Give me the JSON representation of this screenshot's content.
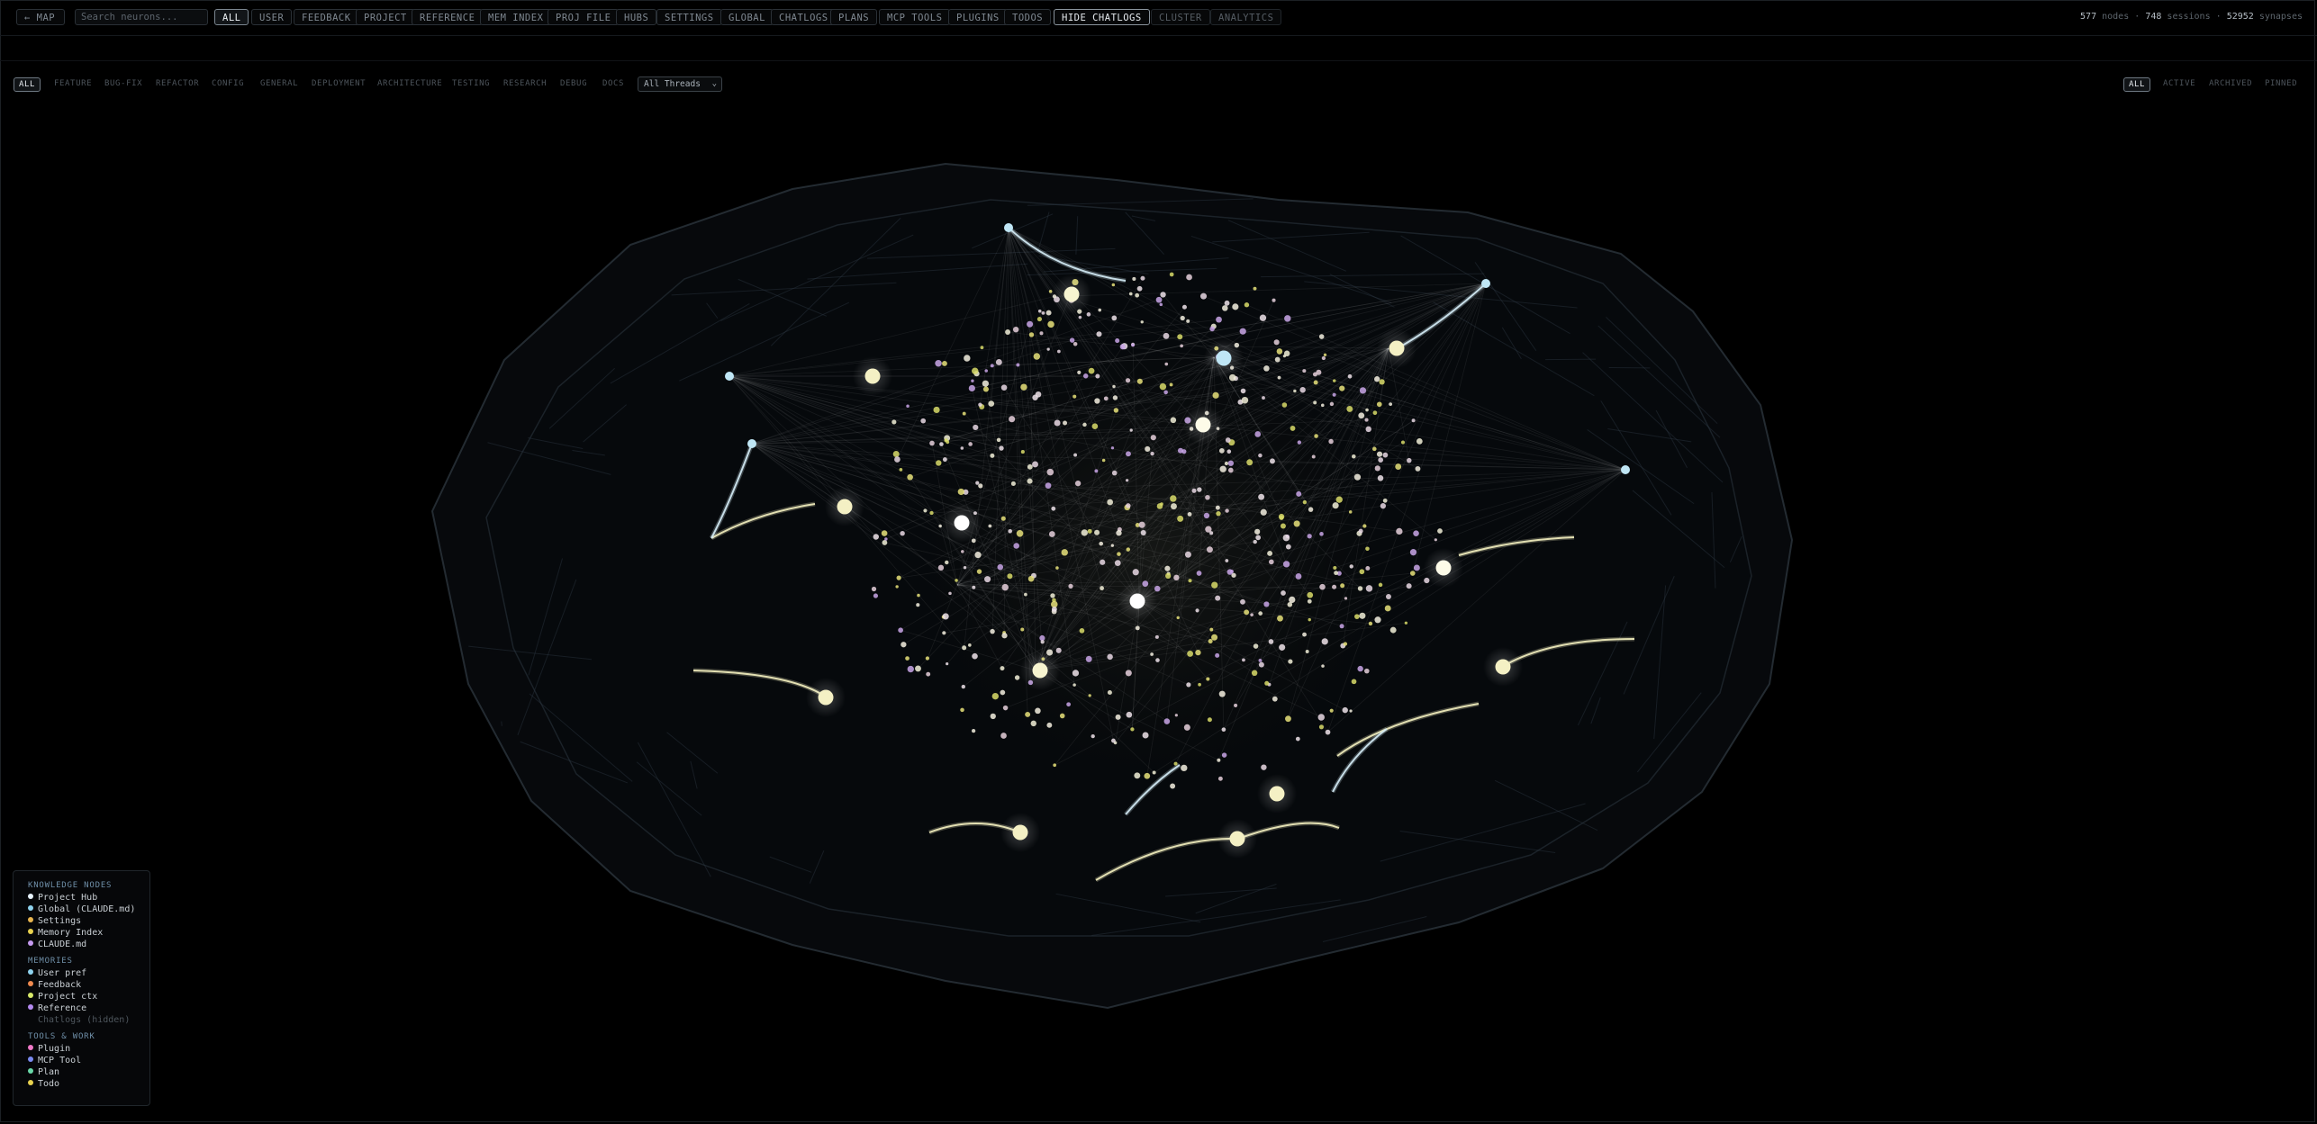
{
  "toolbar": {
    "back_label": "← MAP",
    "search_placeholder": "Search neurons...",
    "filters": [
      "ALL",
      "USER",
      "FEEDBACK",
      "PROJECT",
      "REFERENCE",
      "MEM INDEX",
      "PROJ FILE",
      "HUBS",
      "SETTINGS",
      "GLOBAL",
      "CHATLOGS",
      "PLANS",
      "MCP TOOLS",
      "PLUGINS",
      "TODOS"
    ],
    "active_filter": "ALL",
    "hide_chatlogs_label": "HIDE CHATLOGS",
    "cluster_label": "CLUSTER",
    "analytics_label": "ANALYTICS"
  },
  "stats": {
    "nodes": "577",
    "nodes_label": "nodes",
    "sessions": "748",
    "sessions_label": "sessions",
    "synapses": "52952",
    "synapses_label": "synapses",
    "separator": "·"
  },
  "categories": {
    "items": [
      "ALL",
      "FEATURE",
      "BUG-FIX",
      "REFACTOR",
      "CONFIG",
      "GENERAL",
      "DEPLOYMENT",
      "ARCHITECTURE",
      "TESTING",
      "RESEARCH",
      "DEBUG",
      "DOCS"
    ],
    "active": "ALL",
    "threads_label": "All Threads"
  },
  "status_filters": {
    "items": [
      "ALL",
      "ACTIVE",
      "ARCHIVED",
      "PINNED"
    ],
    "active": "ALL"
  },
  "legend": {
    "knowledge_title": "KNOWLEDGE NODES",
    "knowledge": [
      {
        "label": "Project Hub",
        "color": "#e8f4ff"
      },
      {
        "label": "Global (CLAUDE.md)",
        "color": "#8fd3ee"
      },
      {
        "label": "Settings",
        "color": "#e8b54f"
      },
      {
        "label": "Memory Index",
        "color": "#e8d24f"
      },
      {
        "label": "CLAUDE.md",
        "color": "#c59af0"
      }
    ],
    "memories_title": "MEMORIES",
    "memories": [
      {
        "label": "User pref",
        "color": "#8fd3ee"
      },
      {
        "label": "Feedback",
        "color": "#f08a4f"
      },
      {
        "label": "Project ctx",
        "color": "#d8e96a"
      },
      {
        "label": "Reference",
        "color": "#b48af0"
      }
    ],
    "chatlogs_hidden": "Chatlogs (hidden)",
    "tools_title": "TOOLS & WORK",
    "tools": [
      {
        "label": "Plugin",
        "color": "#f07ac8"
      },
      {
        "label": "MCP Tool",
        "color": "#7a8af0"
      },
      {
        "label": "Plan",
        "color": "#6ad8a8"
      },
      {
        "label": "Todo",
        "color": "#e8d24f"
      }
    ]
  }
}
